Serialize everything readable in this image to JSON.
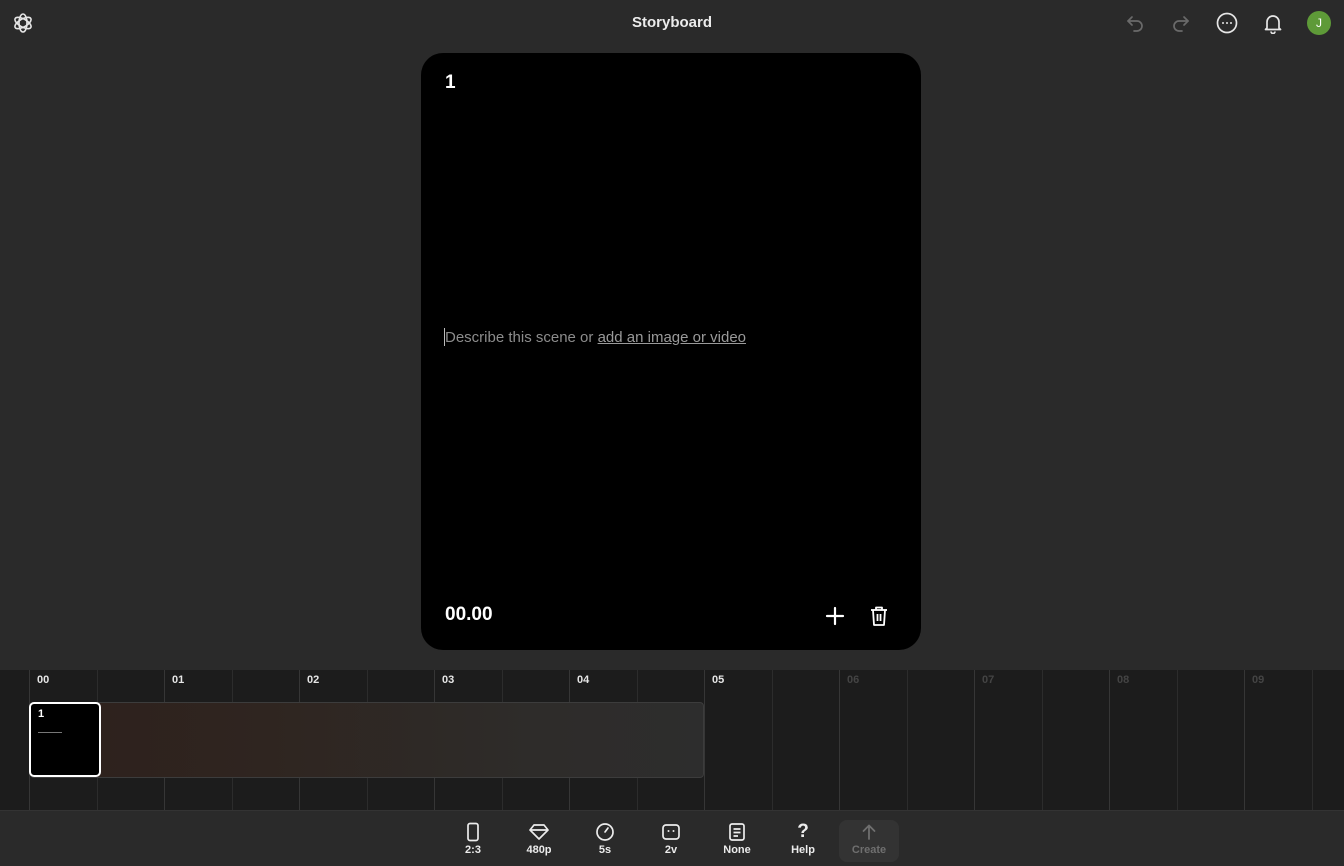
{
  "app": {
    "title": "Storyboard",
    "avatar_initial": "J",
    "avatar_color": "#5e9a38"
  },
  "toolbar": {
    "undo_icon": "undo-icon",
    "redo_icon": "redo-icon",
    "more_icon": "more-icon",
    "notifications_icon": "bell-icon"
  },
  "scene_card": {
    "number": "1",
    "prompt_placeholder": "Describe this scene or ",
    "prompt_link": "add an image or video",
    "timestamp": "00.00"
  },
  "timeline": {
    "ticks": [
      "00",
      "01",
      "02",
      "03",
      "04",
      "05",
      "06",
      "07",
      "08",
      "09"
    ],
    "active_tick_count": 6,
    "scenes": [
      {
        "number": "1"
      }
    ]
  },
  "bottom_tools": [
    {
      "icon": "phone-aspect-icon",
      "label": "2:3"
    },
    {
      "icon": "diamond-quality-icon",
      "label": "480p"
    },
    {
      "icon": "clock-duration-icon",
      "label": "5s"
    },
    {
      "icon": "variations-icon",
      "label": "2v"
    },
    {
      "icon": "preset-icon",
      "label": "None"
    },
    {
      "icon": "help-icon",
      "label": "Help"
    },
    {
      "icon": "arrow-up-icon",
      "label": "Create"
    }
  ]
}
